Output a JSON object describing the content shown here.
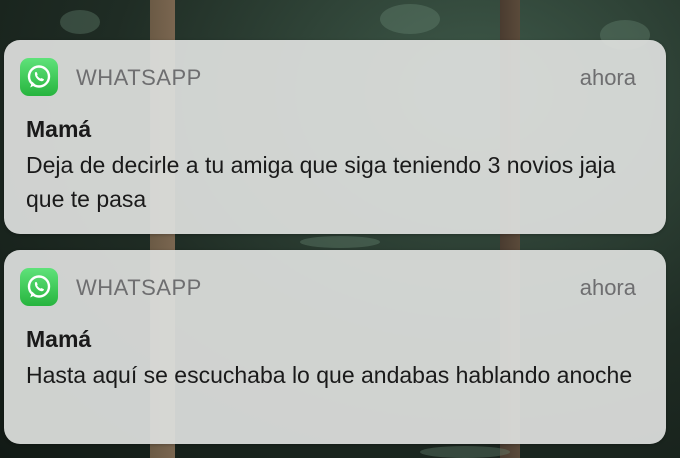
{
  "colors": {
    "whatsapp_green": "#25D366",
    "card_background": "#dedfde",
    "secondary_text": "#6e6e70",
    "primary_text": "#1a1a1a"
  },
  "notifications": [
    {
      "app_icon": "whatsapp-icon",
      "app_name": "WHATSAPP",
      "time": "ahora",
      "sender": "Mamá",
      "message": "Deja de decirle a tu amiga que siga teniendo 3 novios jaja que te pasa"
    },
    {
      "app_icon": "whatsapp-icon",
      "app_name": "WHATSAPP",
      "time": "ahora",
      "sender": "Mamá",
      "message": "Hasta aquí se escuchaba lo que andabas hablando anoche"
    }
  ]
}
